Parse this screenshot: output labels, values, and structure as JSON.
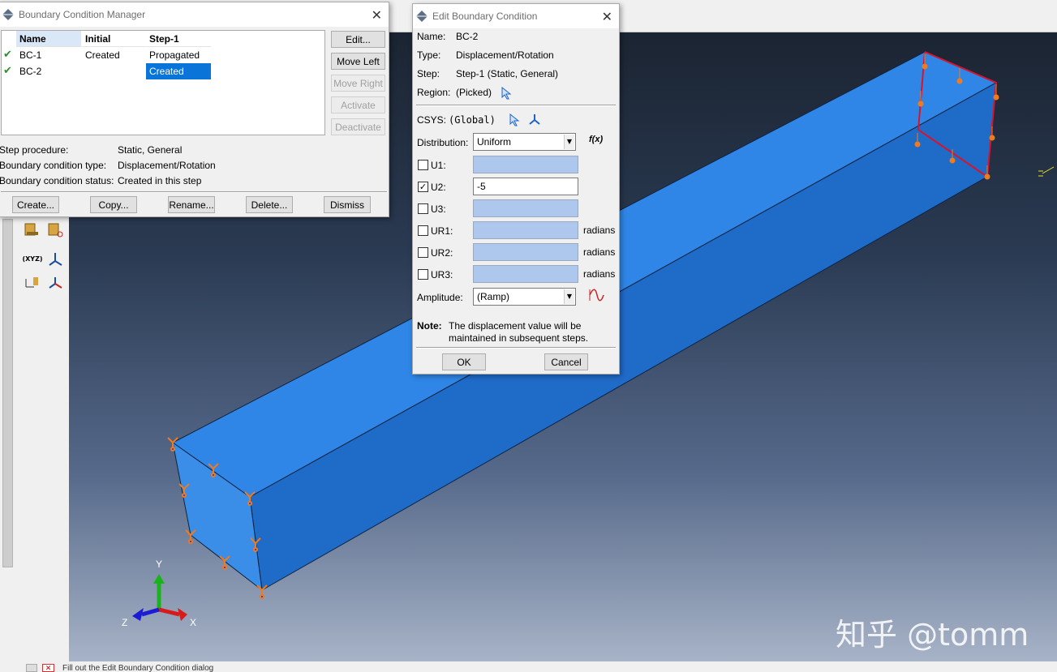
{
  "bc_manager": {
    "title": "Boundary Condition Manager",
    "columns": [
      "Name",
      "Initial",
      "Step-1"
    ],
    "rows": [
      {
        "name": "BC-1",
        "initial": "Created",
        "step1": "Propagated"
      },
      {
        "name": "BC-2",
        "initial": "",
        "step1": "Created"
      }
    ],
    "side_buttons": {
      "edit": "Edit...",
      "move_left": "Move Left",
      "move_right": "Move Right",
      "activate": "Activate",
      "deactivate": "Deactivate"
    },
    "info": {
      "step_procedure_label": "Step procedure:",
      "step_procedure_value": "Static, General",
      "bc_type_label": "Boundary condition type:",
      "bc_type_value": "Displacement/Rotation",
      "bc_status_label": "Boundary condition status:",
      "bc_status_value": "Created in this step"
    },
    "bottom_buttons": {
      "create": "Create...",
      "copy": "Copy...",
      "rename": "Rename...",
      "delete": "Delete...",
      "dismiss": "Dismiss"
    }
  },
  "edit_bc": {
    "title": "Edit Boundary Condition",
    "name_label": "Name:",
    "name_value": "BC-2",
    "type_label": "Type:",
    "type_value": "Displacement/Rotation",
    "step_label": "Step:",
    "step_value": "Step-1 (Static, General)",
    "region_label": "Region:",
    "region_value": "(Picked)",
    "csys_label": "CSYS:",
    "csys_value": "(Global)",
    "distribution_label": "Distribution:",
    "distribution_value": "Uniform",
    "fx_label": "f(x)",
    "dofs": [
      {
        "label": "U1:",
        "checked": false,
        "value": "",
        "unit": ""
      },
      {
        "label": "U2:",
        "checked": true,
        "value": "-5",
        "unit": ""
      },
      {
        "label": "U3:",
        "checked": false,
        "value": "",
        "unit": ""
      },
      {
        "label": "UR1:",
        "checked": false,
        "value": "",
        "unit": "radians"
      },
      {
        "label": "UR2:",
        "checked": false,
        "value": "",
        "unit": "radians"
      },
      {
        "label": "UR3:",
        "checked": false,
        "value": "",
        "unit": "radians"
      }
    ],
    "amplitude_label": "Amplitude:",
    "amplitude_value": "(Ramp)",
    "note_label": "Note:",
    "note_text_1": "The displacement value will be",
    "note_text_2": "maintained in subsequent steps.",
    "ok": "OK",
    "cancel": "Cancel"
  },
  "triad": {
    "x": "X",
    "y": "Y",
    "z": "Z"
  },
  "toolbox": {
    "xyz_label": "(XYZ)"
  },
  "status_bar": {
    "text": "Fill out the Edit Boundary Condition dialog"
  },
  "watermark": "知乎 @tomm",
  "colors": {
    "beam_light": "#2f86e6",
    "beam_dark": "#1a5fb4",
    "selection": "#0a74d9",
    "constraint_orange": "#f07a1e",
    "edge_red": "#d9142a"
  }
}
